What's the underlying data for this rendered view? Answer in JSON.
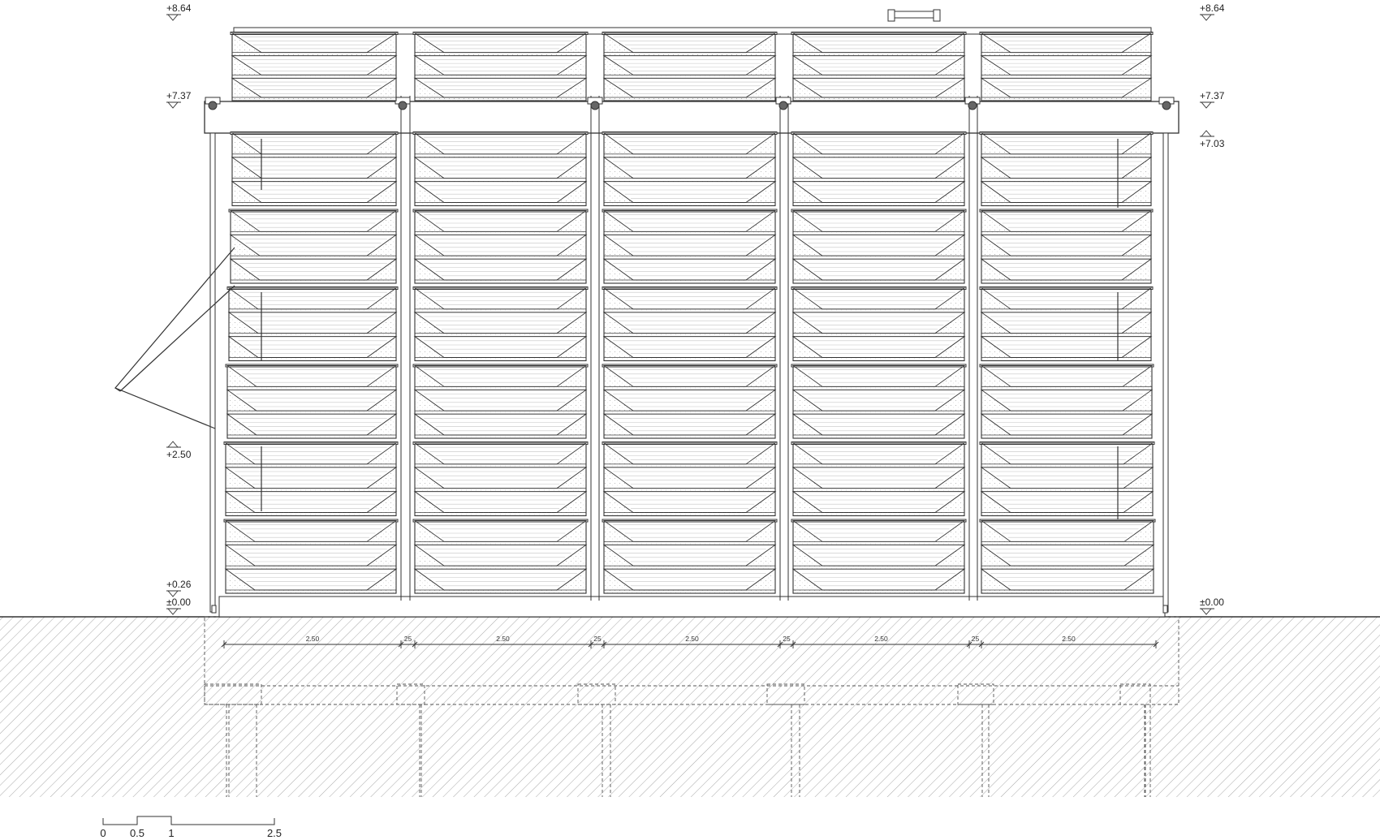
{
  "levels": [
    {
      "id": "top",
      "label": "+8.64",
      "side": "both"
    },
    {
      "id": "roof",
      "label": "+7.37",
      "side": "both"
    },
    {
      "id": "beam",
      "label": "+7.03",
      "side": "right"
    },
    {
      "id": "mid",
      "label": "+2.50",
      "side": "left"
    },
    {
      "id": "plinth",
      "label": "+0.26",
      "side": "left"
    },
    {
      "id": "ground",
      "label": "±0.00",
      "side": "both"
    }
  ],
  "dimensions": [
    "2.50",
    "25",
    "2.50",
    "25",
    "2.50",
    "25",
    "2.50",
    "25",
    "2.50"
  ],
  "scale_bar": {
    "ticks": [
      "0",
      "0.5",
      "1",
      "2.5"
    ]
  },
  "facade": {
    "bays": 5,
    "tiers": 6,
    "rooftop_tier": true
  },
  "colors": {
    "line": "#333333",
    "hatch": "#b0b0b0",
    "fill": "#ffffff"
  }
}
